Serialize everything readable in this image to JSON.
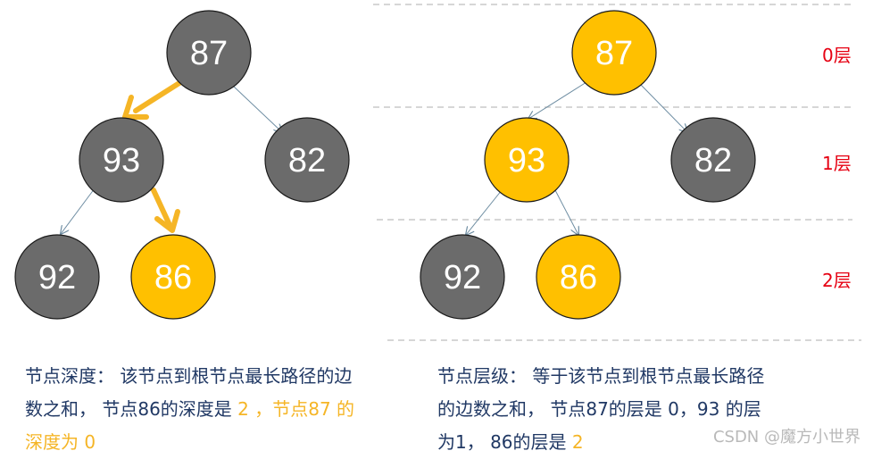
{
  "colors": {
    "node_gray": "#6b6b6b",
    "node_yellow": "#ffc000",
    "arrow_yellow": "#f5b526",
    "edge_blue": "#6f8ea3",
    "layer_red": "#e60012",
    "caption_text": "#203864"
  },
  "left_tree": {
    "nodes": {
      "root": "87",
      "left": "93",
      "right": "82",
      "left_left": "92",
      "left_right": "86"
    }
  },
  "right_tree": {
    "nodes": {
      "root": "87",
      "left": "93",
      "right": "82",
      "left_left": "92",
      "left_right": "86"
    },
    "layers": [
      "0层",
      "1层",
      "2层"
    ]
  },
  "captions": {
    "left": {
      "part1": "节点深度： 该节点到根节点最长路径的边数之和， 节点86的深度是 ",
      "hl1": "2 ，节点87 的深度为 0"
    },
    "right": {
      "part1": "节点层级： 等于该节点到根节点最长路径的边数之和， 节点87的层是 0，93 的层为1， 86的层是 ",
      "hl1": "2"
    }
  },
  "watermark": "CSDN @魔方小世界"
}
